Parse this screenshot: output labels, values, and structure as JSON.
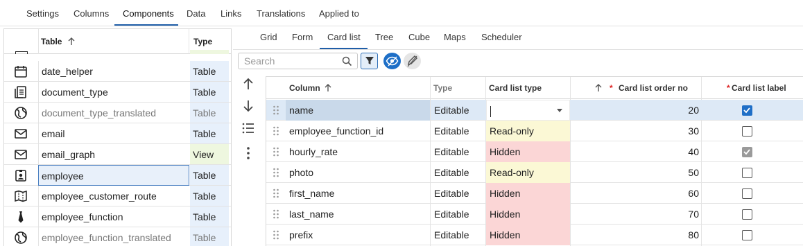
{
  "top_tabs": [
    "Settings",
    "Columns",
    "Components",
    "Data",
    "Links",
    "Translations",
    "Applied to"
  ],
  "top_tab_active": "Components",
  "left_table": {
    "header_name": "Table",
    "header_type": "Type",
    "rows": [
      {
        "name": "date_helper",
        "type": "Table",
        "icon": "calendar-icon",
        "muted": false
      },
      {
        "name": "document_type",
        "type": "Table",
        "icon": "document-icon",
        "muted": false
      },
      {
        "name": "document_type_translated",
        "type": "Table",
        "icon": "globe-icon",
        "muted": true
      },
      {
        "name": "email",
        "type": "Table",
        "icon": "envelope-icon",
        "muted": false
      },
      {
        "name": "email_graph",
        "type": "View",
        "icon": "envelope-icon",
        "muted": false
      },
      {
        "name": "employee",
        "type": "Table",
        "icon": "badge-icon",
        "muted": false
      },
      {
        "name": "employee_customer_route",
        "type": "Table",
        "icon": "map-icon",
        "muted": false
      },
      {
        "name": "employee_function",
        "type": "Table",
        "icon": "tie-icon",
        "muted": false
      },
      {
        "name": "employee_function_translated",
        "type": "Table",
        "icon": "globe-icon",
        "muted": true
      }
    ]
  },
  "sub_tabs": [
    "Grid",
    "Form",
    "Card list",
    "Tree",
    "Cube",
    "Maps",
    "Scheduler"
  ],
  "sub_tab_active": "Card list",
  "search": {
    "placeholder": "Search",
    "value": ""
  },
  "grid": {
    "headers": {
      "column": "Column",
      "type": "Type",
      "card_list_type": "Card list type",
      "order_no": "Card list order no",
      "label": "Card list label"
    },
    "rows": [
      {
        "column": "name",
        "type": "Editable",
        "card_list_type": "",
        "state": "editing",
        "order": "20",
        "label": "checked"
      },
      {
        "column": "employee_function_id",
        "type": "Editable",
        "card_list_type": "Read-only",
        "state": "readonly",
        "order": "30",
        "label": "unchecked"
      },
      {
        "column": "hourly_rate",
        "type": "Editable",
        "card_list_type": "Hidden",
        "state": "hidden",
        "order": "40",
        "label": "checked-grey"
      },
      {
        "column": "photo",
        "type": "Editable",
        "card_list_type": "Read-only",
        "state": "readonly",
        "order": "50",
        "label": "unchecked"
      },
      {
        "column": "first_name",
        "type": "Editable",
        "card_list_type": "Hidden",
        "state": "hidden",
        "order": "60",
        "label": "unchecked"
      },
      {
        "column": "last_name",
        "type": "Editable",
        "card_list_type": "Hidden",
        "state": "hidden",
        "order": "70",
        "label": "unchecked"
      },
      {
        "column": "prefix",
        "type": "Editable",
        "card_list_type": "Hidden",
        "state": "hidden",
        "order": "80",
        "label": "unchecked"
      }
    ]
  },
  "colors": {
    "accent": "#1f5ea8",
    "readonly": "#fbf8d5",
    "hidden": "#fbd6d6",
    "table_type": "#e7f0fb",
    "view_type": "#eef7df"
  }
}
